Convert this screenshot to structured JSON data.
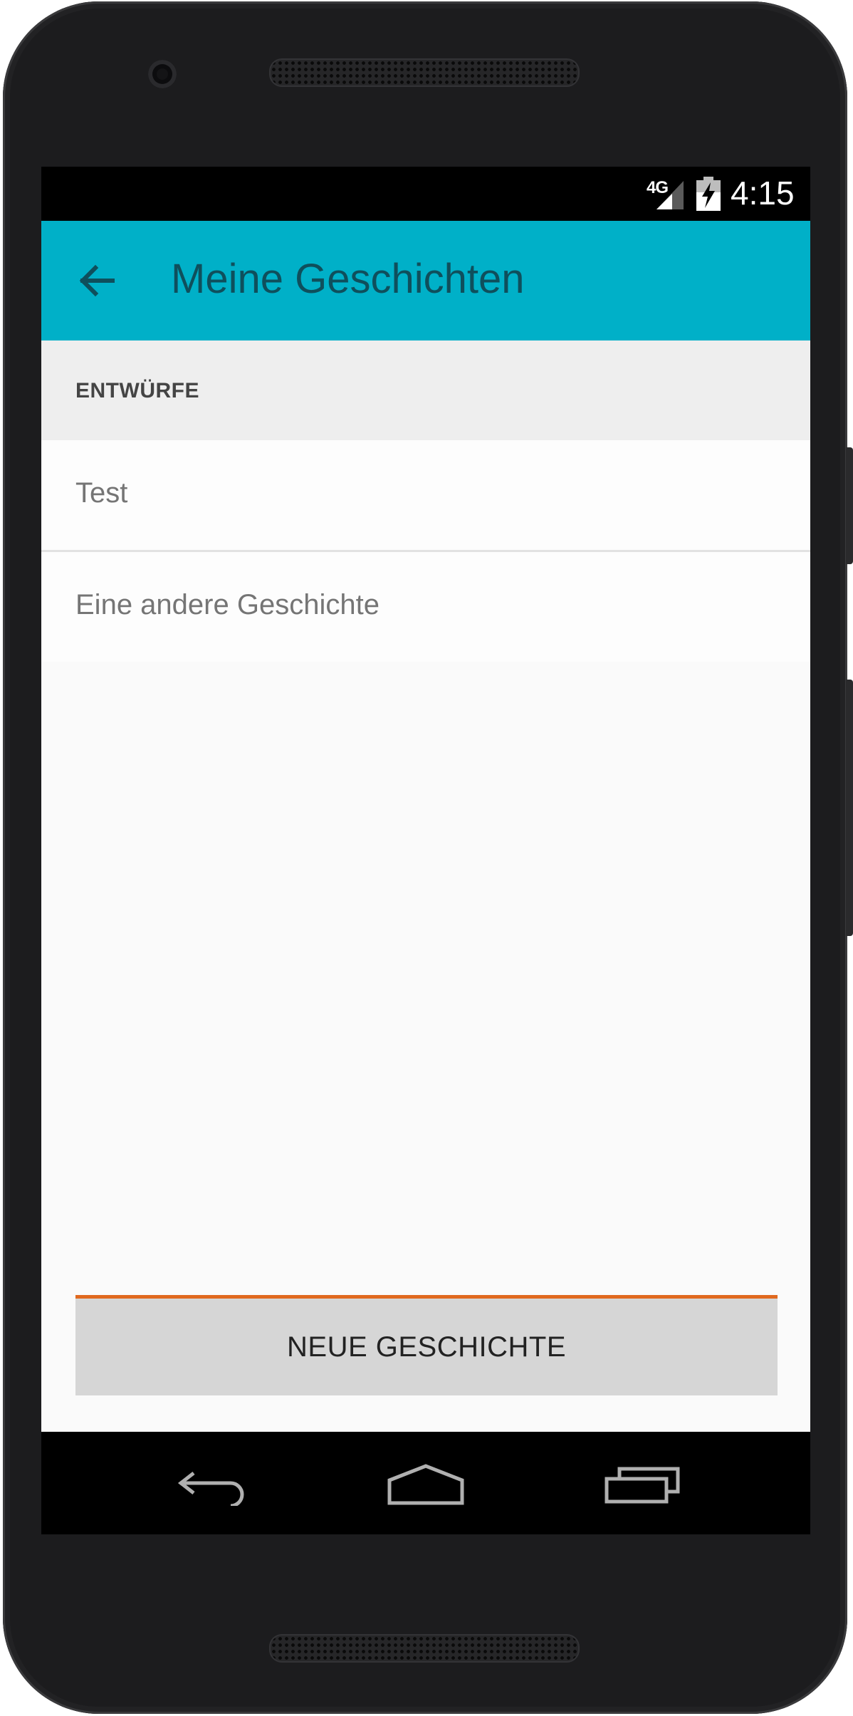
{
  "status_bar": {
    "network": "4G",
    "time": "4:15"
  },
  "app_bar": {
    "title": "Meine Geschichten",
    "back_icon": "arrow-back-icon"
  },
  "section": {
    "header": "ENTWÜRFE"
  },
  "drafts": [
    {
      "title": "Test"
    },
    {
      "title": "Eine andere Geschichte"
    }
  ],
  "actions": {
    "new_story_label": "NEUE GESCHICHTE"
  },
  "colors": {
    "app_bar": "#00b0c8",
    "title_text": "#0f4f5c",
    "button_accent": "#e0691f",
    "button_bg": "#d6d6d6"
  },
  "nav_bar": {
    "icons": [
      "nav-back-icon",
      "nav-home-icon",
      "nav-recents-icon"
    ]
  }
}
